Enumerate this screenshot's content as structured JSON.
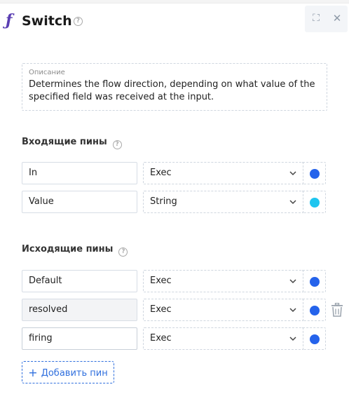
{
  "node": {
    "icon": "function-icon",
    "icon_glyph": "ƒ",
    "title": "Switch",
    "help_glyph": "?"
  },
  "window_controls": {
    "expand_icon": "expand-icon",
    "expand_glyph": "⛶",
    "close_icon": "close-icon",
    "close_glyph": "✕"
  },
  "description": {
    "label": "Описание",
    "text": "Determines the flow direction, depending on what value of the specified field was received at the input."
  },
  "incoming": {
    "title": "Входящие пины",
    "pins": [
      {
        "name": "In",
        "type": "Exec",
        "color": "#2563eb"
      },
      {
        "name": "Value",
        "type": "String",
        "color": "#1ec5ef"
      }
    ]
  },
  "outgoing": {
    "title": "Исходящие пины",
    "pins": [
      {
        "name": "Default",
        "type": "Exec",
        "color": "#2563eb"
      },
      {
        "name": "resolved",
        "type": "Exec",
        "color": "#2563eb"
      },
      {
        "name": "firing",
        "type": "Exec",
        "color": "#2563eb"
      }
    ]
  },
  "add_pin": {
    "plus": "+",
    "label": "Добавить пин"
  }
}
